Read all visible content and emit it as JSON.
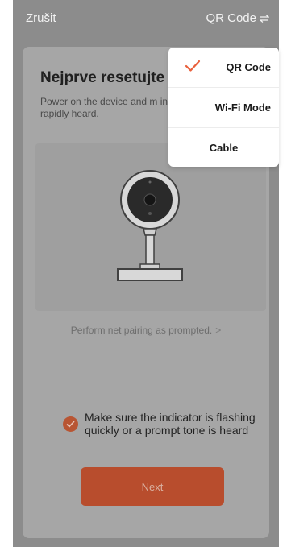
{
  "header": {
    "cancel_label": "Zrušit",
    "mode_label": "QR Code",
    "mode_icon": "swap-arrows-icon"
  },
  "card": {
    "title": "Nejprve resetujte z",
    "description": "Power on the device and m indicator is flashing rapidly heard.",
    "pairing_link": "Perform net pairing as prompted.",
    "confirm_text": "Make sure the indicator is flashing quickly or a prompt tone is heard",
    "next_label": "Next"
  },
  "menu": {
    "items": [
      {
        "label": "QR Code",
        "selected": true
      },
      {
        "label": "Wi-Fi Mode",
        "selected": false
      },
      {
        "label": "Cable",
        "selected": false
      }
    ]
  },
  "colors": {
    "accent": "#b84d2d",
    "check": "#e9603c",
    "overlay": "#8c8c8c"
  }
}
